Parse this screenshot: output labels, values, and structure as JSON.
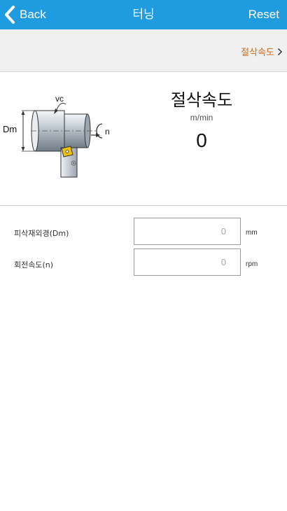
{
  "nav": {
    "back_label": "Back",
    "title": "터닝",
    "reset_label": "Reset",
    "bar_color": "#1f9be0"
  },
  "subbar": {
    "link_label": "절삭속도",
    "link_color": "#d2691e"
  },
  "result": {
    "title": "절삭속도",
    "unit": "m/min",
    "value": "0"
  },
  "diagram": {
    "label_vc": "vc",
    "label_dm": "Dm",
    "label_n": "n"
  },
  "fields": [
    {
      "label": "피삭재외경(Dm)",
      "placeholder": "0",
      "value": "",
      "unit": "mm"
    },
    {
      "label": "회전속도(n)",
      "placeholder": "0",
      "value": "",
      "unit": "rpm"
    }
  ]
}
